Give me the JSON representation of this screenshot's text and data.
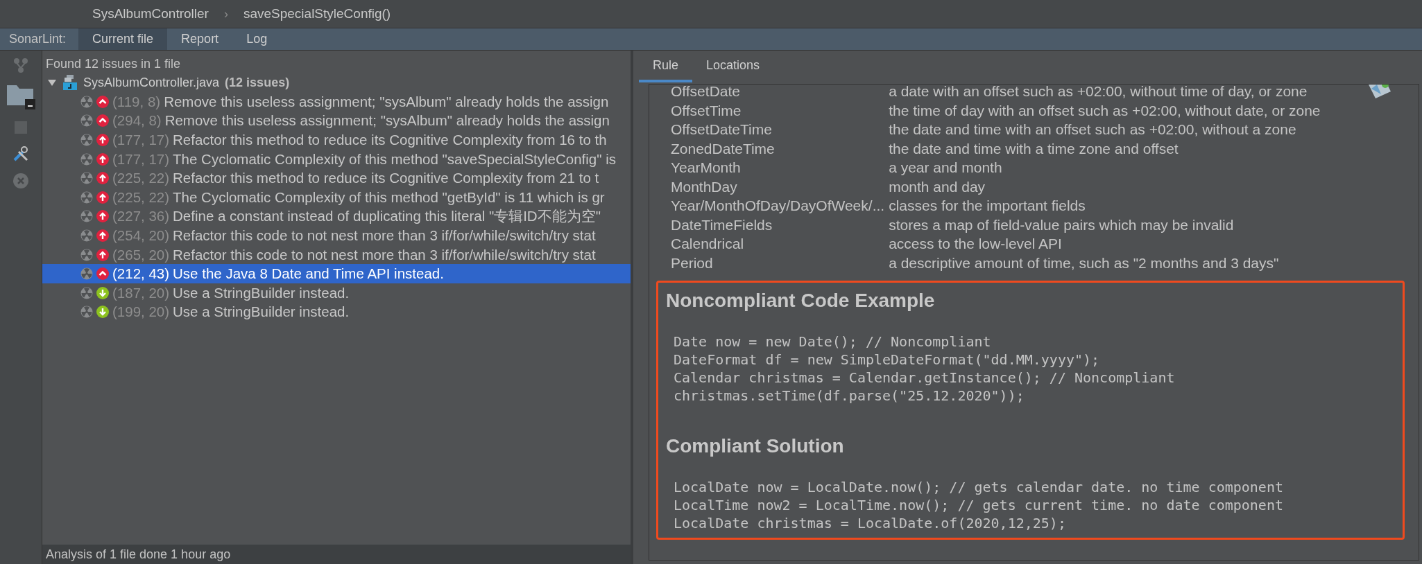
{
  "breadcrumb": {
    "items": [
      "SysAlbumController",
      "saveSpecialStyleConfig()"
    ],
    "separator": "›"
  },
  "toolbar": {
    "label": "SonarLint:",
    "tabs": [
      {
        "label": "Current file",
        "selected": true
      },
      {
        "label": "Report",
        "selected": false
      },
      {
        "label": "Log",
        "selected": false
      }
    ]
  },
  "issues_panel": {
    "summary": "Found 12 issues in 1 file",
    "file": {
      "name": "SysAlbumController.java",
      "count": "(12 issues)",
      "expanded": true,
      "issues": [
        {
          "kind": "critical",
          "location": "(119, 8)",
          "message": "Remove this useless assignment; \"sysAlbum\" already holds the assign",
          "selected": false
        },
        {
          "kind": "critical",
          "location": "(294, 8)",
          "message": "Remove this useless assignment; \"sysAlbum\" already holds the assign",
          "selected": false
        },
        {
          "kind": "major",
          "location": "(177, 17)",
          "message": "Refactor this method to reduce its Cognitive Complexity from 16 to th",
          "selected": false
        },
        {
          "kind": "major",
          "location": "(177, 17)",
          "message": "The Cyclomatic Complexity of this method \"saveSpecialStyleConfig\" is",
          "selected": false
        },
        {
          "kind": "major",
          "location": "(225, 22)",
          "message": "Refactor this method to reduce its Cognitive Complexity from 21 to t",
          "selected": false
        },
        {
          "kind": "major",
          "location": "(225, 22)",
          "message": "The Cyclomatic Complexity of this method \"getById\" is 11 which is gr",
          "selected": false
        },
        {
          "kind": "major",
          "location": "(227, 36)",
          "message": "Define a constant instead of duplicating this literal \"专辑ID不能为空\"",
          "selected": false
        },
        {
          "kind": "major",
          "location": "(254, 20)",
          "message": "Refactor this code to not nest more than 3 if/for/while/switch/try stat",
          "selected": false
        },
        {
          "kind": "major",
          "location": "(265, 20)",
          "message": "Refactor this code to not nest more than 3 if/for/while/switch/try stat",
          "selected": false
        },
        {
          "kind": "critical",
          "location": "(212, 43)",
          "message": "Use the Java 8 Date and Time API instead.",
          "selected": true
        },
        {
          "kind": "minor",
          "location": "(187, 20)",
          "message": "Use a StringBuilder instead.",
          "selected": false
        },
        {
          "kind": "minor",
          "location": "(199, 20)",
          "message": "Use a StringBuilder instead.",
          "selected": false
        }
      ]
    },
    "status": "Analysis of 1 file done 1 hour ago"
  },
  "rule_panel": {
    "tabs": [
      {
        "label": "Rule",
        "selected": true
      },
      {
        "label": "Locations",
        "selected": false
      }
    ],
    "classes": [
      {
        "name": "OffsetDate",
        "description": "a date with an offset such as +02:00, without time of day, or zone"
      },
      {
        "name": "OffsetTime",
        "description": "the time of day with an offset such as +02:00, without date, or zone"
      },
      {
        "name": "OffsetDateTime",
        "description": "the date and time with an offset such as +02:00, without a zone"
      },
      {
        "name": "ZonedDateTime",
        "description": "the date and time with a time zone and offset"
      },
      {
        "name": "YearMonth",
        "description": "a year and month"
      },
      {
        "name": "MonthDay",
        "description": "month and day"
      },
      {
        "name": "Year/MonthOfDay/DayOfWeek/...",
        "description": "classes for the important fields"
      },
      {
        "name": "DateTimeFields",
        "description": "stores a map of field-value pairs which may be invalid"
      },
      {
        "name": "Calendrical",
        "description": "access to the low-level API"
      },
      {
        "name": "Period",
        "description": "a descriptive amount of time, such as \"2 months and 3 days\""
      }
    ],
    "sections": [
      {
        "heading": "Noncompliant Code Example",
        "code": [
          "Date now = new Date(); // Noncompliant",
          "DateFormat df = new SimpleDateFormat(\"dd.MM.yyyy\");",
          "Calendar christmas = Calendar.getInstance(); // Noncompliant",
          "christmas.setTime(df.parse(\"25.12.2020\"));"
        ]
      },
      {
        "heading": "Compliant Solution",
        "code": [
          "LocalDate now = LocalDate.now(); // gets calendar date. no time component",
          "LocalTime now2 = LocalTime.now(); // gets current time. no date component",
          "LocalDate christmas = LocalDate.of(2020,12,25);"
        ]
      }
    ]
  }
}
